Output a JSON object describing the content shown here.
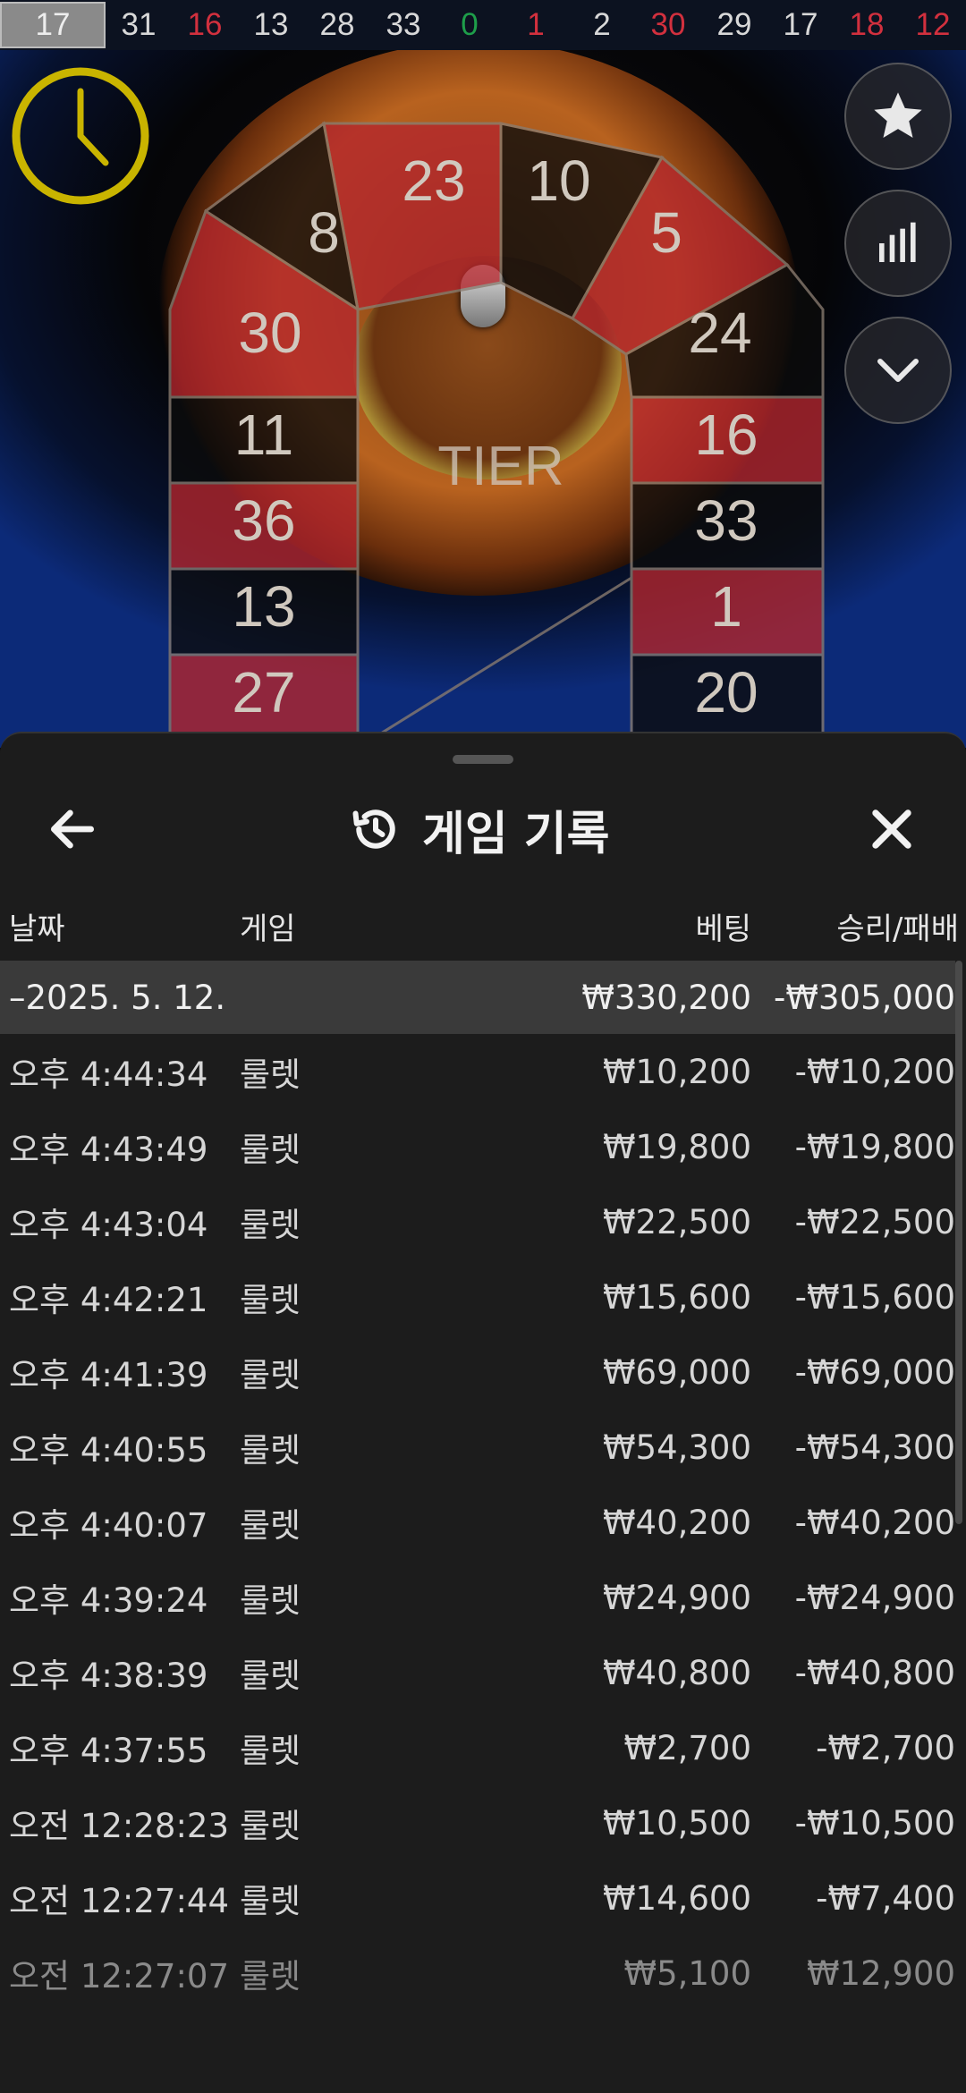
{
  "results_strip": [
    {
      "value": "17",
      "color": "black",
      "latest": true
    },
    {
      "value": "31",
      "color": "black"
    },
    {
      "value": "16",
      "color": "red"
    },
    {
      "value": "13",
      "color": "black"
    },
    {
      "value": "28",
      "color": "black"
    },
    {
      "value": "33",
      "color": "black"
    },
    {
      "value": "0",
      "color": "green"
    },
    {
      "value": "1",
      "color": "red"
    },
    {
      "value": "2",
      "color": "black"
    },
    {
      "value": "30",
      "color": "red"
    },
    {
      "value": "29",
      "color": "black"
    },
    {
      "value": "17",
      "color": "black"
    },
    {
      "value": "18",
      "color": "red"
    },
    {
      "value": "12",
      "color": "red"
    }
  ],
  "scene": {
    "tier_label": "TIER",
    "track_numbers": [
      "23",
      "10",
      "8",
      "5",
      "30",
      "24",
      "11",
      "16",
      "36",
      "33",
      "13",
      "1",
      "27",
      "20"
    ]
  },
  "side_buttons": [
    "star-icon",
    "stats-icon",
    "chevron-down-icon"
  ],
  "sheet": {
    "title": "게임 기록",
    "columns": {
      "date": "날짜",
      "game": "게임",
      "bet": "베팅",
      "result": "승리/패배"
    },
    "summary": {
      "date": "–2025. 5. 12.",
      "bet": "₩330,200",
      "result": "-₩305,000"
    },
    "rows": [
      {
        "time": "오후 4:44:34",
        "game": "룰렛",
        "bet": "₩10,200",
        "result": "-₩10,200"
      },
      {
        "time": "오후 4:43:49",
        "game": "룰렛",
        "bet": "₩19,800",
        "result": "-₩19,800"
      },
      {
        "time": "오후 4:43:04",
        "game": "룰렛",
        "bet": "₩22,500",
        "result": "-₩22,500"
      },
      {
        "time": "오후 4:42:21",
        "game": "룰렛",
        "bet": "₩15,600",
        "result": "-₩15,600"
      },
      {
        "time": "오후 4:41:39",
        "game": "룰렛",
        "bet": "₩69,000",
        "result": "-₩69,000"
      },
      {
        "time": "오후 4:40:55",
        "game": "룰렛",
        "bet": "₩54,300",
        "result": "-₩54,300"
      },
      {
        "time": "오후 4:40:07",
        "game": "룰렛",
        "bet": "₩40,200",
        "result": "-₩40,200"
      },
      {
        "time": "오후 4:39:24",
        "game": "룰렛",
        "bet": "₩24,900",
        "result": "-₩24,900"
      },
      {
        "time": "오후 4:38:39",
        "game": "룰렛",
        "bet": "₩40,800",
        "result": "-₩40,800"
      },
      {
        "time": "오후 4:37:55",
        "game": "룰렛",
        "bet": "₩2,700",
        "result": "-₩2,700"
      },
      {
        "time": "오전 12:28:23",
        "game": "룰렛",
        "bet": "₩10,500",
        "result": "-₩10,500"
      },
      {
        "time": "오전 12:27:44",
        "game": "룰렛",
        "bet": "₩14,600",
        "result": "-₩7,400"
      },
      {
        "time": "오전 12:27:07",
        "game": "룰렛",
        "bet": "₩5,100",
        "result": "₩12,900"
      }
    ]
  },
  "colors": {
    "red": "#d2303e",
    "black": "#d8d8d8",
    "green": "#1e9e4a",
    "sheet_bg": "#1c1c1c",
    "summary_bg": "#3a3a3a",
    "timer": "#c9b400"
  }
}
